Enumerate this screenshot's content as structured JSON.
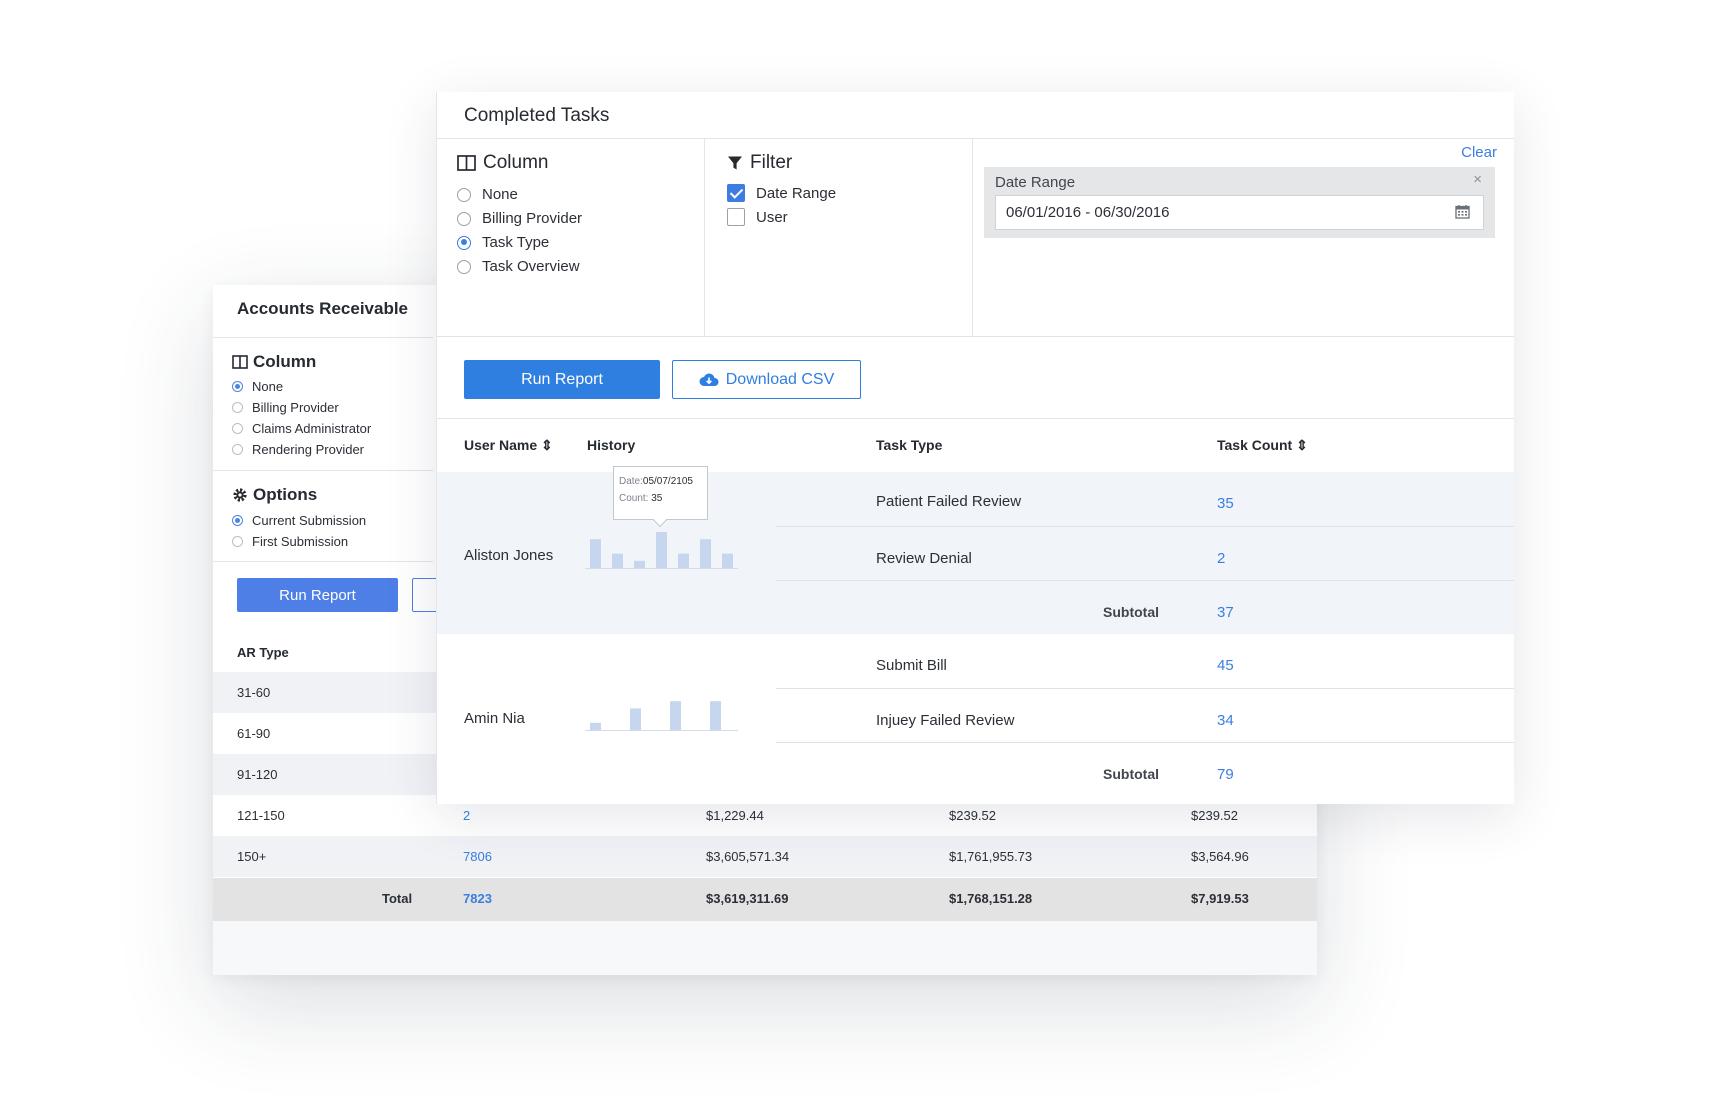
{
  "ar_panel": {
    "title": "Accounts Receivable",
    "column": {
      "heading": "Column",
      "options": [
        "None",
        "Billing Provider",
        "Claims Administrator",
        "Rendering Provider"
      ],
      "selected": "None"
    },
    "options": {
      "heading": "Options",
      "options": [
        "Current Submission",
        "First Submission"
      ],
      "selected": "Current Submission"
    },
    "run_report_label": "Run Report",
    "table": {
      "header_type": "AR Type",
      "rows": [
        {
          "type": "31-60",
          "count": "",
          "c2": "",
          "c3": "",
          "c4": ""
        },
        {
          "type": "61-90",
          "count": "",
          "c2": "",
          "c3": "",
          "c4": ""
        },
        {
          "type": "91-120",
          "count": "",
          "c2": "",
          "c3": "",
          "c4": ""
        },
        {
          "type": "121-150",
          "count": "2",
          "c2": "$1,229.44",
          "c3": "$239.52",
          "c4": "$239.52"
        },
        {
          "type": "150+",
          "count": "7806",
          "c2": "$3,605,571.34",
          "c3": "$1,761,955.73",
          "c4": "$3,564.96"
        }
      ],
      "total": {
        "label": "Total",
        "count": "7823",
        "c2": "$3,619,311.69",
        "c3": "$1,768,151.28",
        "c4": "$7,919.53"
      }
    }
  },
  "ct_panel": {
    "title": "Completed Tasks",
    "column": {
      "heading": "Column",
      "options": [
        "None",
        "Billing Provider",
        "Task Type",
        "Task Overview"
      ],
      "selected": "Task Type"
    },
    "filter": {
      "heading": "Filter",
      "options": [
        {
          "label": "Date Range",
          "checked": true
        },
        {
          "label": "User",
          "checked": false
        }
      ]
    },
    "clear_label": "Clear",
    "date_range": {
      "label": "Date Range",
      "value": "06/01/2016 - 06/30/2016",
      "close_glyph": "×"
    },
    "run_report_label": "Run Report",
    "download_csv_label": "Download CSV",
    "table": {
      "headers": {
        "user": "User Name ⇕",
        "history": "History",
        "task_type": "Task Type",
        "task_count": "Task Count ⇕"
      },
      "groups": [
        {
          "user": "Aliston Jones",
          "history": [
            4,
            2,
            1,
            5,
            2,
            4,
            2
          ],
          "tasks": [
            {
              "type": "Patient Failed Review",
              "count": "35"
            },
            {
              "type": "Review Denial",
              "count": "2"
            }
          ],
          "subtotal_label": "Subtotal",
          "subtotal": "37"
        },
        {
          "user": "Amin Nia",
          "history": [
            1,
            3,
            4,
            4
          ],
          "tasks": [
            {
              "type": "Submit Bill",
              "count": "45"
            },
            {
              "type": "Injuey Failed Review",
              "count": "34"
            }
          ],
          "subtotal_label": "Subtotal",
          "subtotal": "79"
        }
      ],
      "tooltip": {
        "date_label": "Date:",
        "date": "05/07/2105",
        "count_label": "Count:",
        "count": "35"
      }
    }
  },
  "colors": {
    "accent": "#2f7fe0",
    "link": "#3b7de0",
    "spark_bar": "#c6d6ee",
    "row_highlight": "#f1f5f9",
    "total_row": "#e3e3e3"
  },
  "icons": {
    "column": "columns-icon",
    "options": "gear-icon",
    "filter": "filter-icon",
    "calendar": "calendar-icon",
    "download": "cloud-download-icon",
    "close": "close-icon"
  }
}
